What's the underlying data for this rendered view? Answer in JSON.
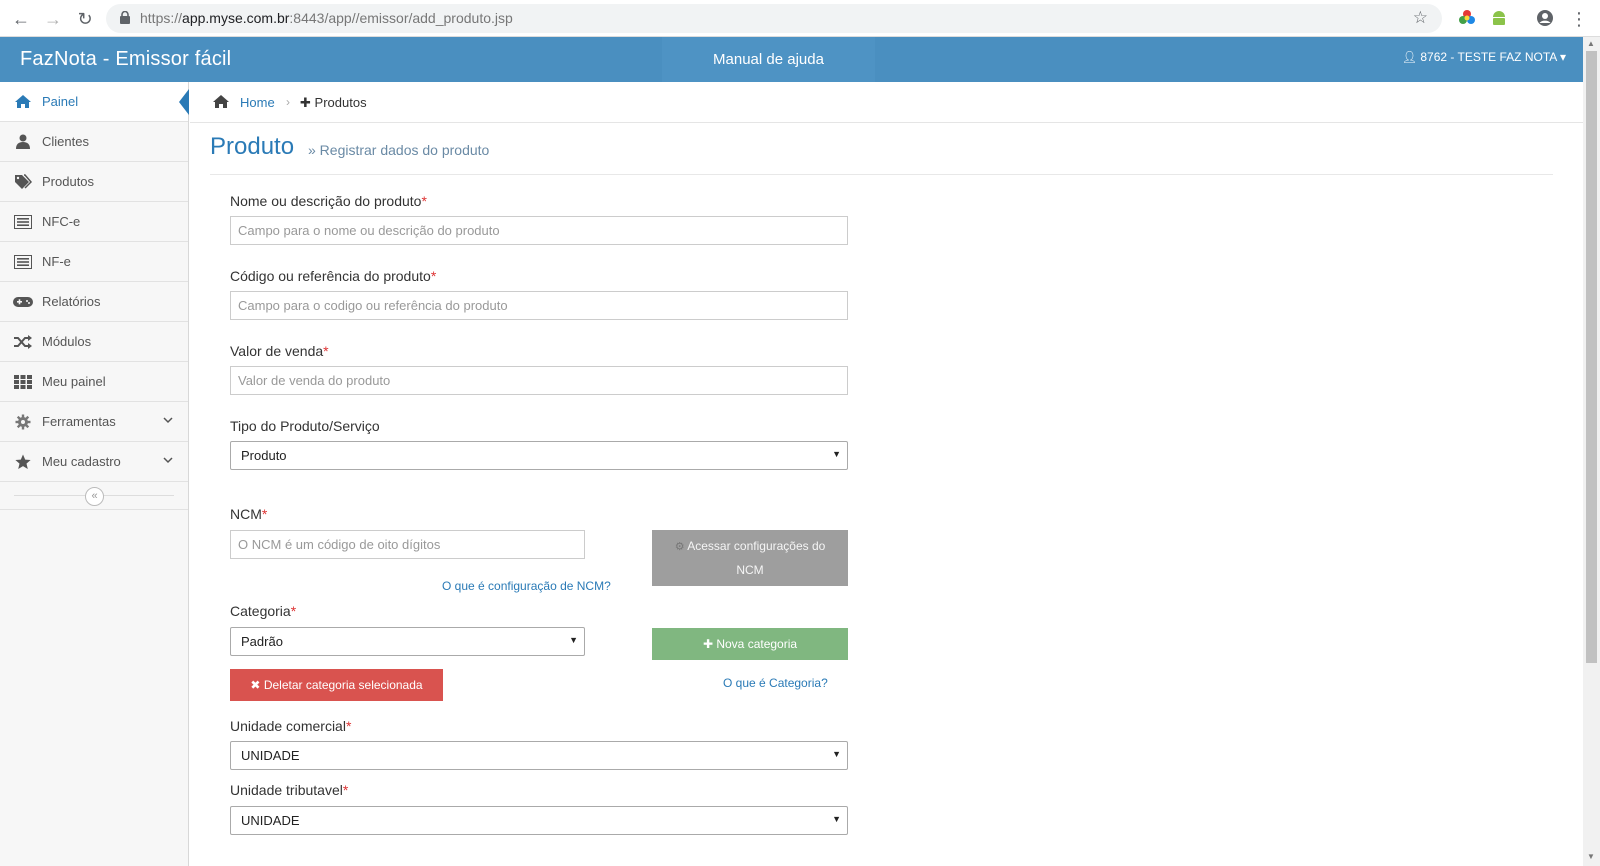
{
  "browser": {
    "url_prefix": "https://",
    "url_host": "app.myse.com.br",
    "url_rest": ":8443/app//emissor/add_produto.jsp"
  },
  "header": {
    "brand": "FazNota - Emissor fácil",
    "help_link": "Manual de ajuda",
    "user_menu": "8762 - TESTE FAZ NOTA"
  },
  "sidebar": {
    "items": [
      {
        "label": "Painel",
        "icon": "home-icon",
        "active": true
      },
      {
        "label": "Clientes",
        "icon": "user-icon"
      },
      {
        "label": "Produtos",
        "icon": "tags-icon"
      },
      {
        "label": "NFC-e",
        "icon": "list-icon"
      },
      {
        "label": "NF-e",
        "icon": "list-icon"
      },
      {
        "label": "Relatórios",
        "icon": "gamepad-icon"
      },
      {
        "label": "Módulos",
        "icon": "random-icon"
      },
      {
        "label": "Meu painel",
        "icon": "grid-icon"
      },
      {
        "label": "Ferramentas",
        "icon": "gear-icon",
        "expandable": true
      },
      {
        "label": "Meu cadastro",
        "icon": "star-icon",
        "expandable": true
      }
    ]
  },
  "breadcrumb": {
    "home": "Home",
    "current": "Produtos"
  },
  "page": {
    "title": "Produto",
    "subtitle": "» Registrar dados do produto"
  },
  "form": {
    "nome_label": "Nome ou descrição do produto",
    "nome_placeholder": "Campo para o nome ou descrição do produto",
    "codigo_label": "Código ou referência do produto",
    "codigo_placeholder": "Campo para o codigo ou referência do produto",
    "valor_label": "Valor de venda",
    "valor_placeholder": "Valor de venda do produto",
    "tipo_label": "Tipo do Produto/Serviço",
    "tipo_value": "Produto",
    "ncm_label": "NCM",
    "ncm_placeholder": "O NCM é um código de oito dígitos",
    "ncm_config_button_line1": "Acessar configurações do",
    "ncm_config_button_line2": "NCM",
    "ncm_help_link": "O que é configuração de NCM?",
    "categoria_label": "Categoria",
    "categoria_value": "Padrão",
    "nova_categoria_button": "Nova categoria",
    "deletar_categoria_button": "Deletar categoria selecionada",
    "categoria_help_link": "O que é Categoria?",
    "unidade_comercial_label": "Unidade comercial",
    "unidade_comercial_value": "UNIDADE",
    "unidade_tributavel_label": "Unidade tributavel",
    "unidade_tributavel_value": "UNIDADE",
    "required_mark": "*"
  },
  "colors": {
    "header_bg": "#4a8fc0",
    "accent": "#2a7ab6",
    "required": "#dd3333",
    "danger": "#d9534f",
    "success": "#80b780"
  }
}
